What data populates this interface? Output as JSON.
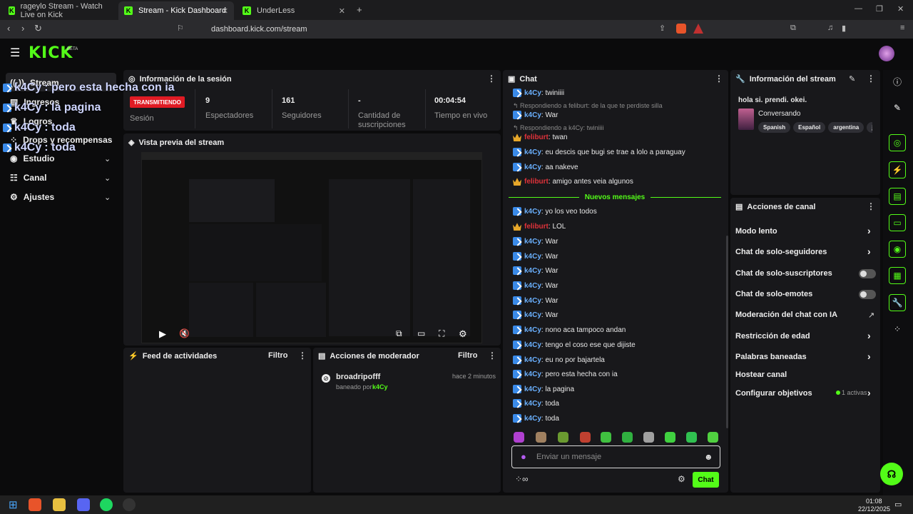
{
  "browser": {
    "tabs": [
      {
        "title": "rageylo Stream - Watch Live on Kick"
      },
      {
        "title": "Stream - Kick Dashboard"
      },
      {
        "title": "UnderLess"
      }
    ],
    "url": "dashboard.kick.com/stream"
  },
  "brand": {
    "logo": "KICK",
    "beta": "BETA",
    "accent": "#53fc18"
  },
  "sidebar": {
    "items": [
      {
        "label": "Stream"
      },
      {
        "label": "Ingresos"
      },
      {
        "label": "Logros"
      },
      {
        "label": "Drops y recompensas"
      },
      {
        "label": "Estudio"
      },
      {
        "label": "Canal"
      },
      {
        "label": "Ajustes"
      }
    ]
  },
  "overlay_messages": [
    {
      "user": "k4Cy",
      "text": ": pero esta hecha con ia"
    },
    {
      "user": "k4Cy",
      "text": ": la pagina"
    },
    {
      "user": "k4Cy",
      "text": ": toda"
    },
    {
      "user": "k4Cy",
      "text": ": toda"
    }
  ],
  "session": {
    "title": "Información de la sesión",
    "status": "TRANSMITIENDO",
    "status_label": "Sesión",
    "stats": [
      {
        "value": "9",
        "label": "Espectadores"
      },
      {
        "value": "161",
        "label": "Seguidores"
      },
      {
        "value": "-",
        "label": "Cantidad de suscripciones"
      },
      {
        "value": "00:04:54",
        "label": "Tiempo en vivo"
      }
    ]
  },
  "preview": {
    "title": "Vista previa del stream"
  },
  "feed": {
    "title": "Feed de actividades",
    "filter": "Filtro"
  },
  "mod": {
    "title": "Acciones de moderador",
    "filter": "Filtro",
    "entry": {
      "user": "broadripofff",
      "action": "baneado por",
      "by": "k4Cy",
      "time": "hace 2 minutos"
    }
  },
  "chat": {
    "title": "Chat",
    "new_messages": "Nuevos mensajes",
    "placeholder": "Enviar un mensaje",
    "send": "Chat",
    "messages": [
      {
        "user": "k4Cy",
        "text": ": twiniiii"
      },
      {
        "reply": "Respondiendo a feliburt: de la que te perdiste silla"
      },
      {
        "user": "k4Cy",
        "text": ": War"
      },
      {
        "reply": "Respondiendo a k4Cy: twiniiii"
      },
      {
        "user": "feliburt",
        "text": ": twan",
        "red": true
      },
      {
        "user": "k4Cy",
        "text": ": eu descis que bugi se trae a lolo a paraguay"
      },
      {
        "user": "k4Cy",
        "text": ": aa nakeve"
      },
      {
        "user": "feliburt",
        "text": ": amigo antes veia algunos",
        "red": true
      },
      {
        "user": "k4Cy",
        "text": ": yo los veo todos"
      },
      {
        "user": "feliburt",
        "text": ": LOL",
        "red": true
      },
      {
        "user": "k4Cy",
        "text": ": War"
      },
      {
        "user": "k4Cy",
        "text": ": War"
      },
      {
        "user": "k4Cy",
        "text": ": War"
      },
      {
        "user": "k4Cy",
        "text": ": War"
      },
      {
        "user": "k4Cy",
        "text": ": War"
      },
      {
        "user": "k4Cy",
        "text": ": War"
      },
      {
        "user": "k4Cy",
        "text": ": nono aca tampoco andan"
      },
      {
        "user": "k4Cy",
        "text": ": tengo el coso ese que dijiste"
      },
      {
        "user": "k4Cy",
        "text": ": eu no por bajartela"
      },
      {
        "user": "k4Cy",
        "text": ": pero esta hecha con ia"
      },
      {
        "user": "k4Cy",
        "text": ": la pagina"
      },
      {
        "user": "k4Cy",
        "text": ": toda"
      },
      {
        "user": "k4Cy",
        "text": ": toda"
      }
    ]
  },
  "stream_info": {
    "title": "Información del stream",
    "stream_title": "hola si. prendi. okei.",
    "category": "Conversando",
    "tags": [
      "Spanish",
      "Español",
      "argentina",
      "jos"
    ]
  },
  "channel_actions": {
    "title": "Acciones de canal",
    "items": [
      {
        "label": "Modo lento"
      },
      {
        "label": "Chat de solo-seguidores"
      },
      {
        "label": "Chat de solo-suscriptores"
      },
      {
        "label": "Chat de solo-emotes"
      },
      {
        "label": "Moderación del chat con IA"
      },
      {
        "label": "Restricción de edad"
      },
      {
        "label": "Palabras baneadas"
      },
      {
        "label": "Hostear canal"
      },
      {
        "label": "Configurar objetivos"
      }
    ],
    "goals_active": "1 activas"
  },
  "taskbar": {
    "time": "01:08",
    "date": "22/12/2025"
  }
}
